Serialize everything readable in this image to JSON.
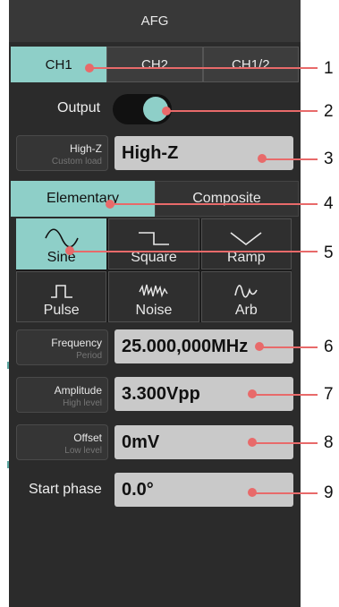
{
  "header": {
    "title": "AFG"
  },
  "channel_tabs": [
    {
      "label": "CH1",
      "active": true
    },
    {
      "label": "CH2",
      "active": false
    },
    {
      "label": "CH1/2",
      "active": false
    }
  ],
  "output": {
    "label": "Output",
    "state": "on"
  },
  "load": {
    "label": "High-Z",
    "sublabel": "Custom load",
    "value": "High-Z"
  },
  "mode_tabs": [
    {
      "label": "Elementary",
      "active": true
    },
    {
      "label": "Composite",
      "active": false
    }
  ],
  "waveforms": [
    {
      "label": "Sine",
      "icon": "sine-wave-icon",
      "active": true
    },
    {
      "label": "Square",
      "icon": "square-wave-icon",
      "active": false
    },
    {
      "label": "Ramp",
      "icon": "ramp-wave-icon",
      "active": false
    },
    {
      "label": "Pulse",
      "icon": "pulse-wave-icon",
      "active": false
    },
    {
      "label": "Noise",
      "icon": "noise-wave-icon",
      "active": false
    },
    {
      "label": "Arb",
      "icon": "arb-wave-icon",
      "active": false
    }
  ],
  "params": {
    "frequency": {
      "label": "Frequency",
      "sublabel": "Period",
      "value": "25.000,000MHz"
    },
    "amplitude": {
      "label": "Amplitude",
      "sublabel": "High level",
      "value": "3.300Vpp"
    },
    "offset": {
      "label": "Offset",
      "sublabel": "Low level",
      "value": "0mV"
    },
    "start_phase": {
      "label": "Start phase",
      "value": "0.0°"
    }
  },
  "annotations": [
    "1",
    "2",
    "3",
    "4",
    "5",
    "6",
    "7",
    "8",
    "9"
  ],
  "colors": {
    "accent": "#8ecfc8",
    "panel": "#2b2b2b",
    "callout": "#e86a6a",
    "value_box": "#c9c9c9"
  }
}
